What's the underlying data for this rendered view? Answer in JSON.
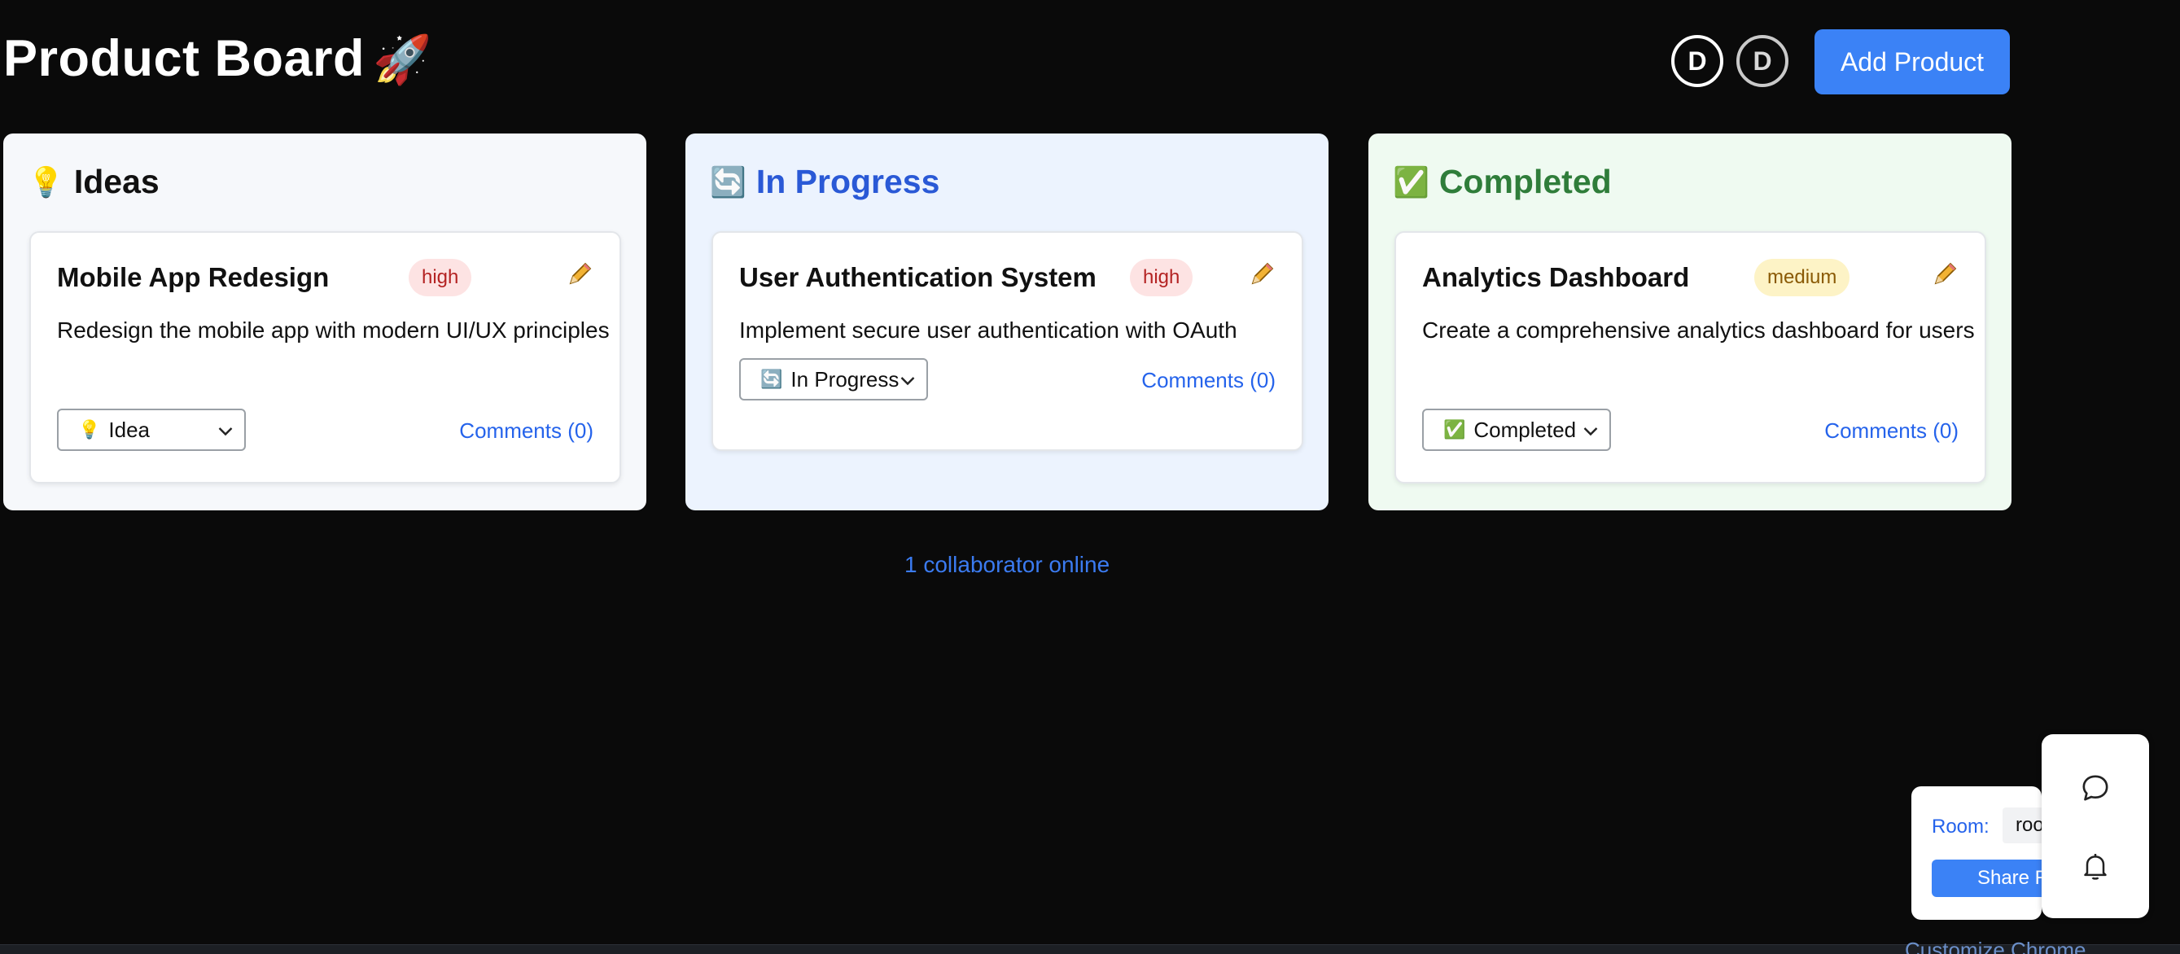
{
  "header": {
    "title": "Product Board",
    "title_emoji": "🚀",
    "avatars": [
      "D",
      "D"
    ],
    "add_button": "Add Product"
  },
  "columns": [
    {
      "title": "Ideas",
      "emoji": "💡",
      "cards": [
        {
          "title": "Mobile App Redesign",
          "priority": "high",
          "description": "Redesign the mobile app with modern UI/UX principles",
          "status": "Idea",
          "status_emoji": "💡",
          "comments": "Comments (0)"
        }
      ]
    },
    {
      "title": "In Progress",
      "emoji": "🔄",
      "cards": [
        {
          "title": "User Authentication System",
          "priority": "high",
          "description": "Implement secure user authentication with OAuth",
          "status": "In Progress",
          "status_emoji": "🔄",
          "comments": "Comments (0)"
        }
      ]
    },
    {
      "title": "Completed",
      "emoji": "✅",
      "cards": [
        {
          "title": "Analytics Dashboard",
          "priority": "medium",
          "description": "Create a comprehensive analytics dashboard for users",
          "status": "Completed",
          "status_emoji": "✅",
          "comments": "Comments (0)"
        }
      ]
    }
  ],
  "collaborators": "1 collaborator online",
  "room_panel": {
    "label": "Room:",
    "value": "roo",
    "share_button": "Share R"
  },
  "tool_rail": {
    "icons": [
      "chat-bubble-icon",
      "bell-icon"
    ]
  },
  "footer": {
    "customize": "Customize Chrome"
  },
  "colors": {
    "background": "#0a0a0a",
    "accent": "#3b82f6",
    "ideas_bg": "#f6f8fb",
    "in_progress_bg": "#ecf3fe",
    "completed_bg": "#effaf1",
    "high_badge": "#fde3e3",
    "medium_badge": "#fdf3c6"
  }
}
